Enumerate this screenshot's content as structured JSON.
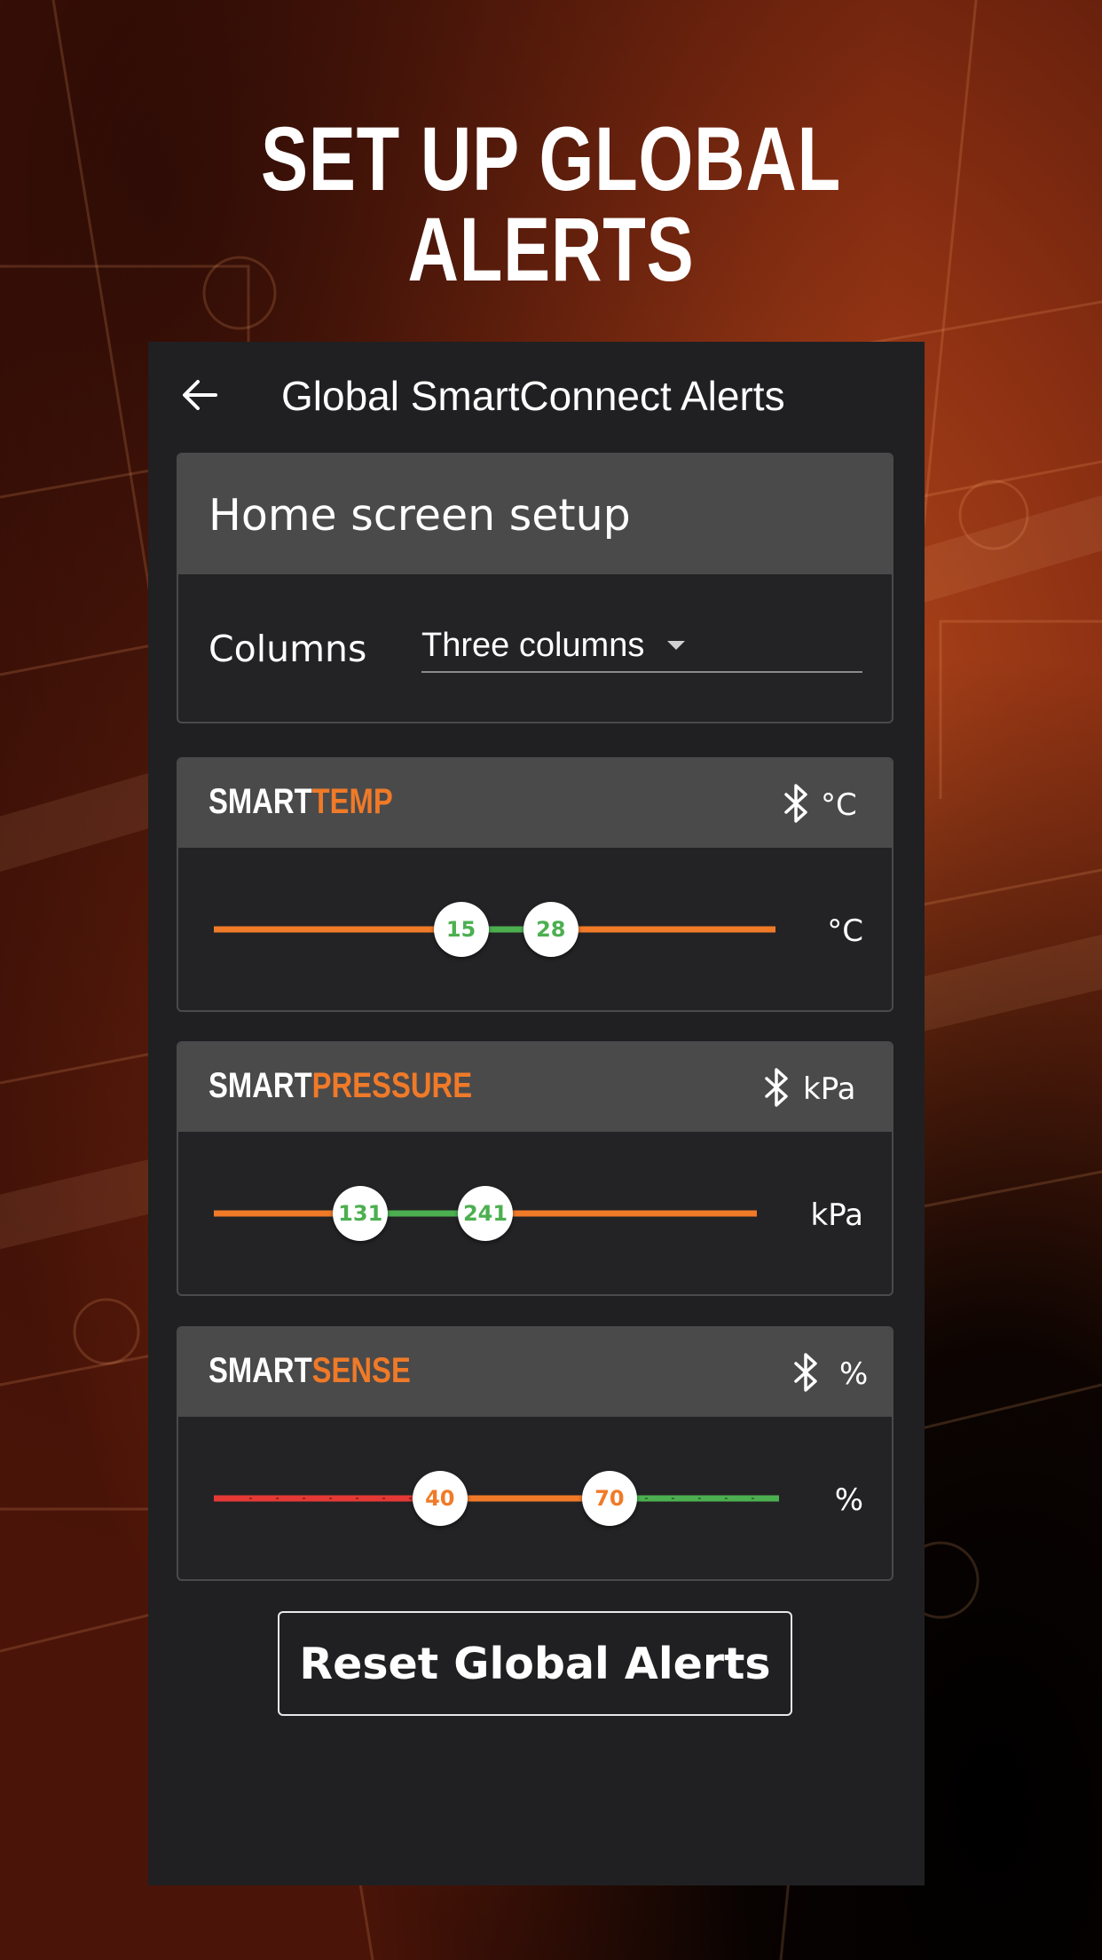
{
  "headline": "SET UP GLOBAL ALERTS",
  "appbar": {
    "title": "Global SmartConnect Alerts",
    "back_icon": "arrow-left-icon"
  },
  "home_setup": {
    "title": "Home screen setup",
    "columns_label": "Columns",
    "columns_value": "Three columns"
  },
  "sensors": [
    {
      "brand_a": "SMART",
      "brand_b": "TEMP",
      "icon": "bluetooth-icon",
      "header_unit": "°C",
      "row_unit": "°C",
      "low": "15",
      "high": "28",
      "low_frac": 0.44,
      "high_frac": 0.6,
      "outer_color": "#f07a28",
      "inner_color": "#4caf50",
      "knob_text_color": "#4caf50"
    },
    {
      "brand_a": "SMART",
      "brand_b": "PRESSURE",
      "icon": "bluetooth-icon",
      "header_unit": "kPa",
      "row_unit": "kPa",
      "low": "131",
      "high": "241",
      "low_frac": 0.27,
      "high_frac": 0.5,
      "outer_color": "#f07a28",
      "inner_color": "#4caf50",
      "knob_text_color": "#4caf50"
    },
    {
      "brand_a": "SMART",
      "brand_b": "SENSE",
      "icon": "bluetooth-icon",
      "header_unit": "%",
      "row_unit": "%",
      "low": "40",
      "high": "70",
      "low_frac": 0.4,
      "high_frac": 0.7,
      "left_color": "#e53935",
      "inner_color": "#f07a28",
      "right_color": "#4caf50",
      "knob_text_color": "#f07a28"
    }
  ],
  "reset_label": "Reset Global Alerts",
  "colors": {
    "accent": "#f07a28",
    "ok": "#4caf50",
    "alert": "#e53935",
    "panel": "#202022",
    "header": "#4a4a4b"
  }
}
